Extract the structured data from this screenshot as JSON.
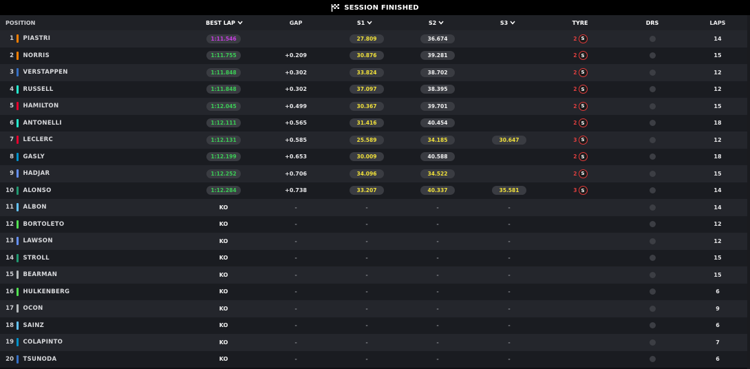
{
  "banner": {
    "title": "SESSION FINISHED",
    "icon": "checkered-flag-icon"
  },
  "headers": {
    "position": "POSITION",
    "best_lap": "BEST LAP",
    "gap": "GAP",
    "s1": "S1",
    "s2": "S2",
    "s3": "S3",
    "tyre": "TYRE",
    "drs": "DRS",
    "laps": "LAPS"
  },
  "colors": {
    "purple": "#c63ee0",
    "green": "#3ccd56",
    "yellow": "#f0e03a",
    "soft_tyre": "#e23a3a"
  },
  "rows": [
    {
      "pos": "1",
      "name": "PIASTRI",
      "team_color": "#ff8000",
      "best": "1:11.546",
      "best_color": "purple",
      "gap": "",
      "s1": "27.809",
      "s1_color": "yellow",
      "s2": "36.674",
      "s2_color": "white",
      "s3": "",
      "s3_color": "",
      "tyre_age": "2",
      "tyre": "S",
      "laps": "14"
    },
    {
      "pos": "2",
      "name": "NORRIS",
      "team_color": "#ff8000",
      "best": "1:11.755",
      "best_color": "green",
      "gap": "+0.209",
      "s1": "30.876",
      "s1_color": "yellow",
      "s2": "39.281",
      "s2_color": "white",
      "s3": "",
      "s3_color": "",
      "tyre_age": "2",
      "tyre": "S",
      "laps": "15"
    },
    {
      "pos": "3",
      "name": "VERSTAPPEN",
      "team_color": "#3671c6",
      "best": "1:11.848",
      "best_color": "green",
      "gap": "+0.302",
      "s1": "33.824",
      "s1_color": "yellow",
      "s2": "38.702",
      "s2_color": "white",
      "s3": "",
      "s3_color": "",
      "tyre_age": "2",
      "tyre": "S",
      "laps": "12"
    },
    {
      "pos": "4",
      "name": "RUSSELL",
      "team_color": "#27f4d2",
      "best": "1:11.848",
      "best_color": "green",
      "gap": "+0.302",
      "s1": "37.097",
      "s1_color": "yellow",
      "s2": "38.395",
      "s2_color": "white",
      "s3": "",
      "s3_color": "",
      "tyre_age": "2",
      "tyre": "S",
      "laps": "12"
    },
    {
      "pos": "5",
      "name": "HAMILTON",
      "team_color": "#e8002d",
      "best": "1:12.045",
      "best_color": "green",
      "gap": "+0.499",
      "s1": "30.367",
      "s1_color": "yellow",
      "s2": "39.701",
      "s2_color": "white",
      "s3": "",
      "s3_color": "",
      "tyre_age": "2",
      "tyre": "S",
      "laps": "15"
    },
    {
      "pos": "6",
      "name": "ANTONELLI",
      "team_color": "#27f4d2",
      "best": "1:12.111",
      "best_color": "green",
      "gap": "+0.565",
      "s1": "31.416",
      "s1_color": "yellow",
      "s2": "40.454",
      "s2_color": "white",
      "s3": "",
      "s3_color": "",
      "tyre_age": "2",
      "tyre": "S",
      "laps": "18"
    },
    {
      "pos": "7",
      "name": "LECLERC",
      "team_color": "#e8002d",
      "best": "1:12.131",
      "best_color": "green",
      "gap": "+0.585",
      "s1": "25.589",
      "s1_color": "yellow",
      "s2": "34.185",
      "s2_color": "yellow",
      "s3": "30.647",
      "s3_color": "yellow",
      "tyre_age": "3",
      "tyre": "S",
      "laps": "12"
    },
    {
      "pos": "8",
      "name": "GASLY",
      "team_color": "#0093cc",
      "best": "1:12.199",
      "best_color": "green",
      "gap": "+0.653",
      "s1": "30.009",
      "s1_color": "yellow",
      "s2": "40.588",
      "s2_color": "white",
      "s3": "",
      "s3_color": "",
      "tyre_age": "2",
      "tyre": "S",
      "laps": "18"
    },
    {
      "pos": "9",
      "name": "HADJAR",
      "team_color": "#6692ff",
      "best": "1:12.252",
      "best_color": "green",
      "gap": "+0.706",
      "s1": "34.096",
      "s1_color": "yellow",
      "s2": "34.522",
      "s2_color": "yellow",
      "s3": "",
      "s3_color": "",
      "tyre_age": "2",
      "tyre": "S",
      "laps": "15"
    },
    {
      "pos": "10",
      "name": "ALONSO",
      "team_color": "#229971",
      "best": "1:12.284",
      "best_color": "green",
      "gap": "+0.738",
      "s1": "33.207",
      "s1_color": "yellow",
      "s2": "40.337",
      "s2_color": "yellow",
      "s3": "35.581",
      "s3_color": "yellow",
      "tyre_age": "3",
      "tyre": "S",
      "laps": "14"
    },
    {
      "pos": "11",
      "name": "ALBON",
      "team_color": "#64c4ff",
      "best": "KO",
      "best_color": "plain",
      "gap": "-",
      "s1": "-",
      "s1_color": "dot",
      "s2": "-",
      "s2_color": "dot",
      "s3": "-",
      "s3_color": "dot",
      "tyre_age": "",
      "tyre": "",
      "laps": "14"
    },
    {
      "pos": "12",
      "name": "BORTOLETO",
      "team_color": "#52e252",
      "best": "KO",
      "best_color": "plain",
      "gap": "-",
      "s1": "-",
      "s1_color": "dot",
      "s2": "-",
      "s2_color": "dot",
      "s3": "-",
      "s3_color": "dot",
      "tyre_age": "",
      "tyre": "",
      "laps": "12"
    },
    {
      "pos": "13",
      "name": "LAWSON",
      "team_color": "#6692ff",
      "best": "KO",
      "best_color": "plain",
      "gap": "-",
      "s1": "-",
      "s1_color": "dot",
      "s2": "-",
      "s2_color": "dot",
      "s3": "-",
      "s3_color": "dot",
      "tyre_age": "",
      "tyre": "",
      "laps": "12"
    },
    {
      "pos": "14",
      "name": "STROLL",
      "team_color": "#229971",
      "best": "KO",
      "best_color": "plain",
      "gap": "-",
      "s1": "-",
      "s1_color": "dot",
      "s2": "-",
      "s2_color": "dot",
      "s3": "-",
      "s3_color": "dot",
      "tyre_age": "",
      "tyre": "",
      "laps": "15"
    },
    {
      "pos": "15",
      "name": "BEARMAN",
      "team_color": "#b6babd",
      "best": "KO",
      "best_color": "plain",
      "gap": "-",
      "s1": "-",
      "s1_color": "dot",
      "s2": "-",
      "s2_color": "dot",
      "s3": "-",
      "s3_color": "dot",
      "tyre_age": "",
      "tyre": "",
      "laps": "15"
    },
    {
      "pos": "16",
      "name": "HULKENBERG",
      "team_color": "#52e252",
      "best": "KO",
      "best_color": "plain",
      "gap": "-",
      "s1": "-",
      "s1_color": "dot",
      "s2": "-",
      "s2_color": "dot",
      "s3": "-",
      "s3_color": "dot",
      "tyre_age": "",
      "tyre": "",
      "laps": "6"
    },
    {
      "pos": "17",
      "name": "OCON",
      "team_color": "#b6babd",
      "best": "KO",
      "best_color": "plain",
      "gap": "-",
      "s1": "-",
      "s1_color": "dot",
      "s2": "-",
      "s2_color": "dot",
      "s3": "-",
      "s3_color": "dot",
      "tyre_age": "",
      "tyre": "",
      "laps": "9"
    },
    {
      "pos": "18",
      "name": "SAINZ",
      "team_color": "#64c4ff",
      "best": "KO",
      "best_color": "plain",
      "gap": "-",
      "s1": "-",
      "s1_color": "dot",
      "s2": "-",
      "s2_color": "dot",
      "s3": "-",
      "s3_color": "dot",
      "tyre_age": "",
      "tyre": "",
      "laps": "6"
    },
    {
      "pos": "19",
      "name": "COLAPINTO",
      "team_color": "#0093cc",
      "best": "KO",
      "best_color": "plain",
      "gap": "-",
      "s1": "-",
      "s1_color": "dot",
      "s2": "-",
      "s2_color": "dot",
      "s3": "-",
      "s3_color": "dot",
      "tyre_age": "",
      "tyre": "",
      "laps": "7"
    },
    {
      "pos": "20",
      "name": "TSUNODA",
      "team_color": "#3671c6",
      "best": "KO",
      "best_color": "plain",
      "gap": "-",
      "s1": "-",
      "s1_color": "dot",
      "s2": "-",
      "s2_color": "dot",
      "s3": "-",
      "s3_color": "dot",
      "tyre_age": "",
      "tyre": "",
      "laps": "6"
    }
  ]
}
